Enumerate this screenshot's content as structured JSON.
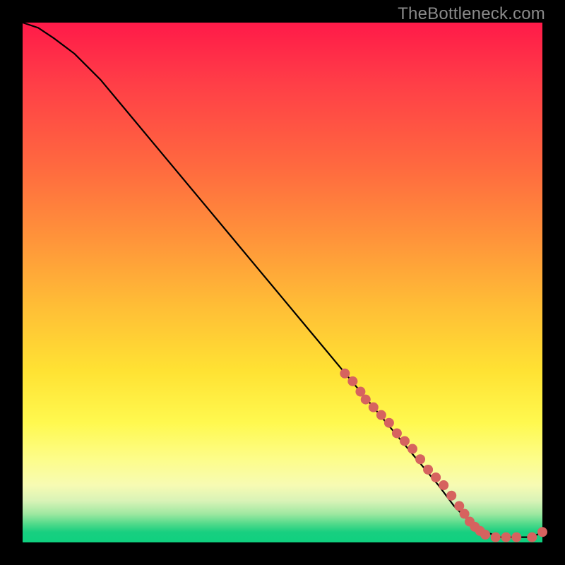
{
  "watermark": "TheBottleneck.com",
  "chart_data": {
    "type": "line",
    "title": "",
    "xlabel": "",
    "ylabel": "",
    "xlim": [
      0,
      100
    ],
    "ylim": [
      0,
      100
    ],
    "curve": {
      "x": [
        0,
        3,
        6,
        10,
        15,
        20,
        25,
        30,
        35,
        40,
        45,
        50,
        55,
        60,
        65,
        70,
        75,
        80,
        83,
        86,
        89,
        92,
        95,
        98,
        100
      ],
      "y": [
        100,
        99,
        97,
        94,
        89,
        83,
        77,
        71,
        65,
        59,
        53,
        47,
        41,
        35,
        29,
        23,
        17,
        11,
        7,
        4,
        2,
        1,
        1,
        1,
        2
      ]
    },
    "highlight_points": {
      "x": [
        62,
        63.5,
        65,
        66,
        67.5,
        69,
        70.5,
        72,
        73.5,
        75,
        76.5,
        78,
        79.5,
        81,
        82.5,
        84,
        85,
        86,
        87,
        88,
        89,
        91,
        93,
        95,
        98,
        100
      ],
      "y": [
        32.5,
        31,
        29,
        27.5,
        26,
        24.5,
        23,
        21,
        19.5,
        18,
        16,
        14,
        12.5,
        11,
        9,
        7,
        5.5,
        4,
        3,
        2.2,
        1.5,
        1,
        1,
        1,
        1,
        2
      ]
    },
    "colors": {
      "curve": "#000000",
      "point_fill": "#d6635f",
      "point_stroke": "#a84b47"
    }
  }
}
